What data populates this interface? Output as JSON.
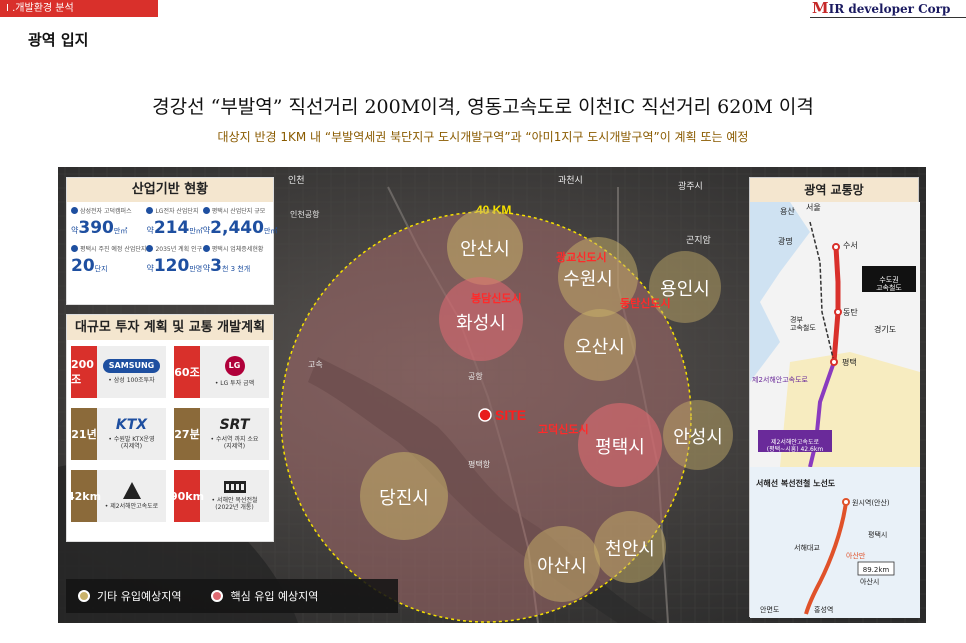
{
  "header": {
    "section_tag": "Ⅰ .개발환경 분석",
    "brand_mark": "M",
    "brand_text": "IR developer Corp",
    "page_subtitle": "광역 입지"
  },
  "headline": "경강선 “부발역” 직선거리 200M이격, 영동고속도로 이천IC 직선거리 620M 이격",
  "subheadline": "대상지 반경 1KM 내 “부발역세권 북단지구 도시개발구역”과 “아미1지구 도시개발구역”이 계획 또는 예정",
  "industry_panel": {
    "title": "산업기반 현황",
    "stats": [
      {
        "caption": "삼성전자 고덕캠퍼스",
        "prefix": "약",
        "value": "390",
        "unit": "만㎡"
      },
      {
        "caption": "LG전자 산업단지",
        "prefix": "약",
        "value": "214",
        "unit": "만㎡"
      },
      {
        "caption": "평택시 산업단지 규모",
        "prefix": "약",
        "value": "2,440",
        "unit": "만㎡"
      },
      {
        "caption": "평택시 주진 예정 산업단지",
        "prefix": "",
        "value": "20",
        "unit": "단지"
      },
      {
        "caption": "2035년 계획 인구",
        "prefix": "약",
        "value": "120",
        "unit": "만명"
      },
      {
        "caption": "평택시 업체증세현황",
        "prefix": "약",
        "value": "3",
        "unit": "천 3 천개"
      }
    ]
  },
  "invest_panel": {
    "title": "대규모 투자 계획 및 교통 개발계획",
    "items": [
      {
        "badge": "200조",
        "logo": "SAMSUNG",
        "logo_type": "samsung",
        "text": "• 삼성 100조투자"
      },
      {
        "badge": "60조",
        "logo": "LG",
        "logo_type": "lg",
        "text": "• LG 투자 금액"
      },
      {
        "badge": "21년",
        "logo": "KTX",
        "logo_type": "ktx",
        "text": "• 수원발 KTX운영\n(지제역)"
      },
      {
        "badge": "27분",
        "logo": "SRT",
        "logo_type": "srt",
        "text": "• 수서역 까지 소요\n(지제역)"
      },
      {
        "badge": "42km",
        "logo": "",
        "logo_type": "road",
        "text": "• 제2서해안고속도로"
      },
      {
        "badge": "90km",
        "logo": "",
        "logo_type": "rail",
        "text": "• 서해안 복선전철\n(2022년 개통)"
      }
    ]
  },
  "map": {
    "radius_label": "40 KM",
    "site_label": "SITE",
    "cities": [
      {
        "name": "안산시",
        "kind": "other"
      },
      {
        "name": "수원시",
        "kind": "other"
      },
      {
        "name": "용인시",
        "kind": "other"
      },
      {
        "name": "화성시",
        "kind": "core"
      },
      {
        "name": "오산시",
        "kind": "other"
      },
      {
        "name": "안성시",
        "kind": "other"
      },
      {
        "name": "평택시",
        "kind": "core"
      },
      {
        "name": "당진시",
        "kind": "other"
      },
      {
        "name": "천안시",
        "kind": "other"
      },
      {
        "name": "아산시",
        "kind": "other"
      }
    ],
    "new_towns": [
      "광교신도시",
      "봉담신도시",
      "동탄신도시",
      "고덕신도시"
    ],
    "place_labels": [
      "인천",
      "과천시",
      "광주시",
      "곤지암",
      "공항",
      "고속",
      "인천공항",
      "평택항"
    ]
  },
  "transport_panel": {
    "title": "광역 교통망",
    "places_top": [
      "용산",
      "서울",
      "수서",
      "광명",
      "동탄",
      "평택",
      "경기도"
    ],
    "line_labels": [
      "경부\n고속철도",
      "제2서해안고속도로"
    ],
    "callout_high_speed": "수도권\n고속철도",
    "callout_expressway": "제2서해안고속도로\n(평택~시흥) 42.6km",
    "section_title": "서해선 복선전철 노선도",
    "places_bottom": [
      "원시역(안산)",
      "평택시",
      "서해대교",
      "아산만",
      "아산시",
      "홍성역",
      "안면도"
    ],
    "distance": "89.2km"
  },
  "legend": {
    "other_label": "기타 유입예상지역",
    "core_label": "핵심 유입 예상지역"
  },
  "colors": {
    "accent_red": "#d9302b",
    "panel_head": "#f4e6cf",
    "other_zone": "#c9b26a",
    "core_zone": "#e06a72",
    "radius_ring": "#f5e000"
  }
}
